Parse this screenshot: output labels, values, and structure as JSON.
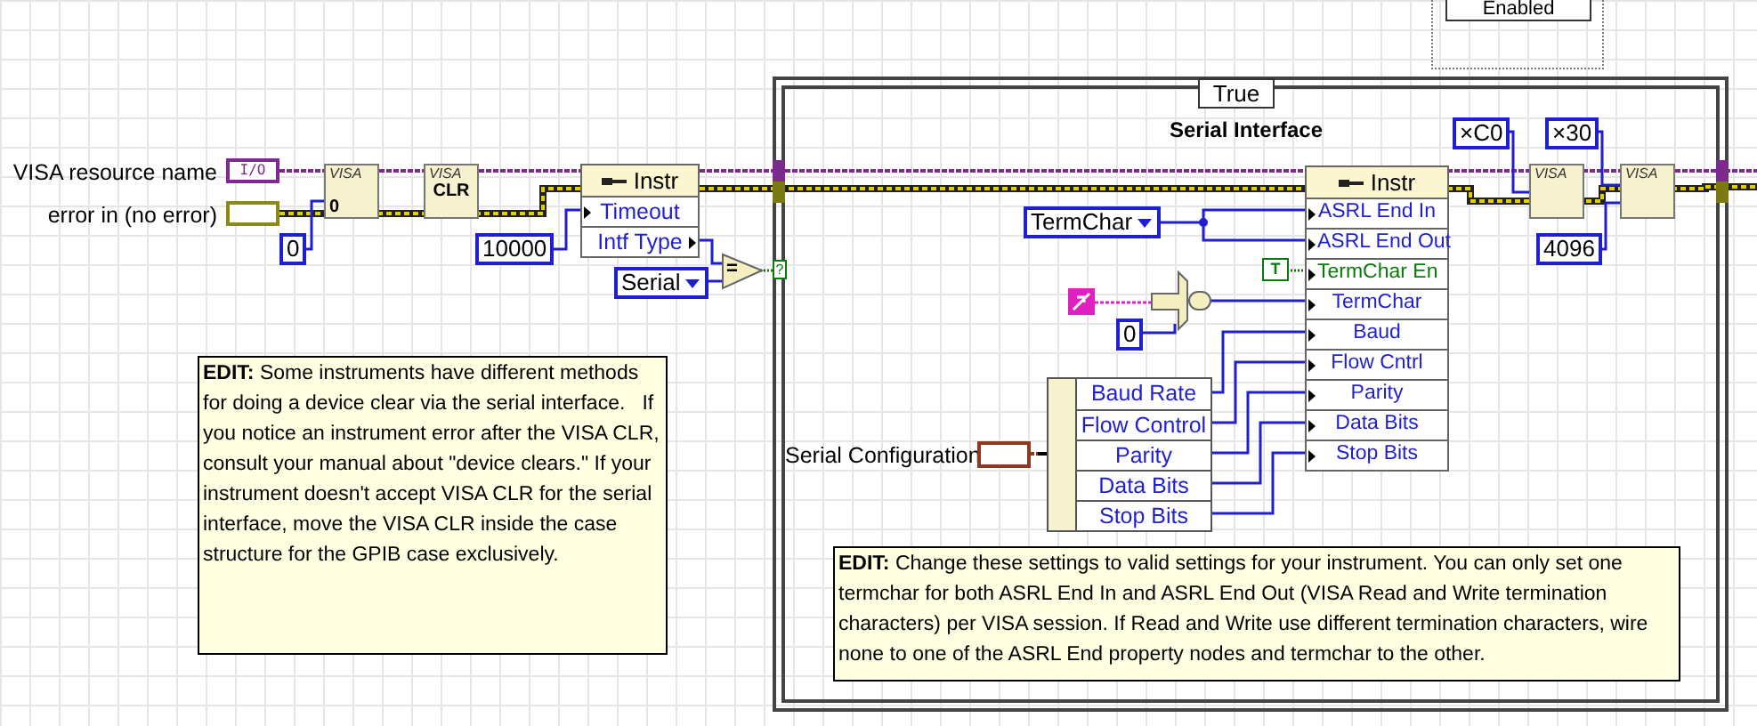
{
  "disable_structure": {
    "selector": "Enabled"
  },
  "inputs": [
    {
      "label": "VISA resource name",
      "kind": "visa",
      "glyph": "I/O"
    },
    {
      "label": "error in (no error)",
      "kind": "error"
    }
  ],
  "open_node": {
    "caption": "VISA",
    "mode": "0"
  },
  "open_timeout": "0",
  "clear_node": {
    "caption": "VISA",
    "text": "CLR"
  },
  "outer_property_node": {
    "header": "Instr",
    "properties": [
      {
        "name": "Timeout",
        "kind": "write",
        "color": "#1f1fd0"
      },
      {
        "name": "Intf Type",
        "kind": "read",
        "color": "#1f1fd0"
      }
    ]
  },
  "timeout_constant": "10000",
  "interface_enum": "Serial",
  "compare_glyph": "=",
  "selector_terminal": "?",
  "outer_comment": "**EDIT:** Some instruments have different methods for doing a device clear via the serial interface.   If you notice an instrument error after the VISA CLR, consult your manual about \"device clears.\" If your instrument doesn't accept VISA CLR for the serial interface, move the VISA CLR inside the case  structure for the GPIB case exclusively.",
  "case_structure": {
    "selector": "True",
    "label": "Serial Interface",
    "termchar_enum": "TermChar",
    "bool_constant": "T",
    "char_constant": "0",
    "property_node": {
      "header": "Instr",
      "properties": [
        {
          "name": "ASRL End In",
          "kind": "write",
          "color": "#1f1fd0"
        },
        {
          "name": "ASRL End Out",
          "kind": "write",
          "color": "#1f1fd0"
        },
        {
          "name": "TermChar En",
          "kind": "write",
          "color": "#0a7a0a"
        },
        {
          "name": "TermChar",
          "kind": "write",
          "color": "#1f1fd0"
        },
        {
          "name": "Baud",
          "kind": "write",
          "color": "#1f1fd0"
        },
        {
          "name": "Flow Cntrl",
          "kind": "write",
          "color": "#1f1fd0"
        },
        {
          "name": "Parity",
          "kind": "write",
          "color": "#1f1fd0"
        },
        {
          "name": "Data Bits",
          "kind": "write",
          "color": "#1f1fd0"
        },
        {
          "name": "Stop Bits",
          "kind": "write",
          "color": "#1f1fd0"
        }
      ]
    },
    "cluster_label": "Serial Configuration",
    "unbundle_fields": [
      "Baud Rate",
      "Flow Control",
      "Parity",
      "Data Bits",
      "Stop Bits"
    ],
    "hex_constants": [
      "×C0",
      "×30"
    ],
    "buffer_size": "4096",
    "visa_nodes": [
      {
        "caption": "VISA"
      },
      {
        "caption": "VISA"
      }
    ],
    "comment": "**EDIT:** Change these settings to valid settings for your instrument. You can only set one termchar for both ASRL End In and ASRL End Out (VISA Read and Write termination characters) per VISA session. If Read and Write use different termination characters, wire none to one of the ASRL End property nodes and termchar to the other."
  }
}
